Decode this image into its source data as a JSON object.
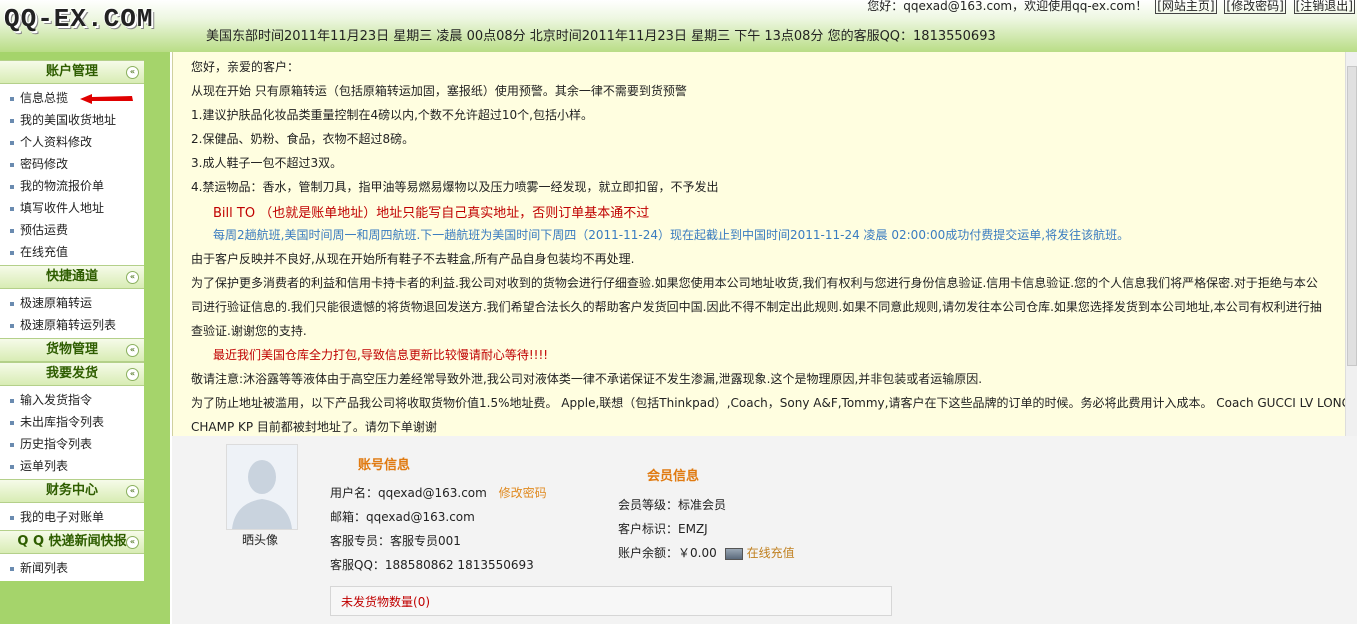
{
  "header": {
    "logo": "QQ-EX.COM",
    "greeting": "您好：qqexad@163.com，欢迎使用qq-ex.com！",
    "links": [
      "[网站主页]",
      "[修改密码]",
      "[注销退出]"
    ],
    "time_info": "美国东部时间2011年11月23日 星期三 凌晨 00点08分 北京时间2011年11月23日 星期三 下午 13点08分 您的客服QQ：1813550693"
  },
  "sidebar": {
    "sections": [
      {
        "title": "账户管理",
        "toggle": "«",
        "items": [
          "信息总揽",
          "我的美国收货地址",
          "个人资料修改",
          "密码修改",
          "我的物流报价单",
          "填写收件人地址",
          "预估运费",
          "在线充值"
        ]
      },
      {
        "title": "快捷通道",
        "toggle": "«",
        "items": [
          "极速原箱转运",
          "极速原箱转运列表"
        ]
      },
      {
        "title": "货物管理",
        "toggle": "«",
        "items": []
      },
      {
        "title": "我要发货",
        "toggle": "«",
        "items": [
          "输入发货指令",
          "未出库指令列表",
          "历史指令列表",
          "运单列表"
        ]
      },
      {
        "title": "财务中心",
        "toggle": "«",
        "items": [
          "我的电子对账单"
        ]
      },
      {
        "title": "Q Q 快递新闻快报",
        "toggle": "«",
        "items": [
          "新闻列表"
        ]
      }
    ]
  },
  "notice": {
    "lines": [
      "您好，亲爱的客户：",
      "从现在开始 只有原箱转运（包括原箱转运加固，塞报纸）使用预警。其余一律不需要到货预警",
      "1.建议护肤品化妆品类重量控制在4磅以内,个数不允许超过10个,包括小样。",
      "2.保健品、奶粉、食品，衣物不超过8磅。",
      "3.成人鞋子一包不超过3双。",
      "4.禁运物品：香水，管制刀具，指甲油等易燃易爆物以及压力喷雾一经发现，就立即扣留，不予发出",
      "Bill TO （也就是账单地址）地址只能写自己真实地址，否则订单基本通不过",
      "每周2趟航班,美国时间周一和周四航班.下一趟航班为美国时间下周四（2011-11-24）现在起截止到中国时间2011-11-24 凌晨 02:00:00成功付费提交运单,将发往该航班。",
      "由于客户反映并不良好,从现在开始所有鞋子不去鞋盒,所有产品自身包装均不再处理.",
      "为了保护更多消费者的利益和信用卡持卡者的利益.我公司对收到的货物会进行仔细查验.如果您使用本公司地址收货,我们有权利与您进行身份信息验证.信用卡信息验证.您的个人信息我们将严格保密.对于拒绝与本公",
      "司进行验证信息的.我们只能很遗憾的将货物退回发送方.我们希望合法长久的帮助客户发货回中国.因此不得不制定出此规则.如果不同意此规则,请勿发往本公司仓库.如果您选择发货到本公司地址,本公司有权利进行抽",
      "查验证.谢谢您的支持.",
      "最近我们美国仓库全力打包,导致信息更新比较慢请耐心等待!!!!",
      "敬请注意:沐浴露等等液体由于高空压力差经常导致外泄,我公司对液体类一律不承诺保证不发生渗漏,泄露现象.这个是物理原因,并非包装或者运输原因.",
      "为了防止地址被滥用，以下产品我公司将收取货物价值1.5%地址费。 Apple,联想（包括Thinkpad）,Coach，Sony A&F,Tommy,请客户在下这些品牌的订单的时候。务必将此费用计入成本。 Coach GUCCI LV LONG",
      "CHAMP KP 目前都被封地址了。请勿下单谢谢"
    ]
  },
  "account": {
    "avatar_label": "晒头像",
    "account_title": "账号信息",
    "username_label": "用户名：",
    "username": "qqexad@163.com",
    "change_password": "修改密码",
    "email_label": "邮箱：",
    "email": "qqexad@163.com",
    "agent_label": "客服专员：",
    "agent": "客服专员001",
    "qq_label": "客服QQ：",
    "qq": "188580862  1813550693",
    "member_title": "会员信息",
    "level_label": "会员等级：",
    "level": "标准会员",
    "id_label": "客户标识：",
    "id": "EMZJ",
    "balance_label": "账户余额：",
    "balance": "￥0.00",
    "recharge": "在线充值",
    "unshipped_label": "未发货物数量",
    "unshipped_count": "(0)"
  },
  "colors": {
    "accent_red": "#c00000",
    "accent_blue": "#3a7cc0",
    "sidebar_green": "#a5d46b",
    "notice_bg": "#fffee0"
  }
}
